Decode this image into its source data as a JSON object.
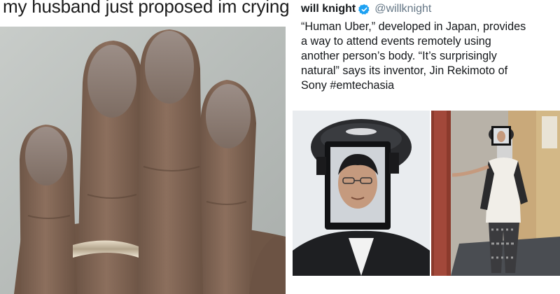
{
  "meme": {
    "caption": "my husband just proposed im crying"
  },
  "tweet": {
    "display_name": "will knight",
    "handle": "@willknight",
    "text_lines": [
      "“Human Uber,” developed in Japan, provides",
      "a way to attend events remotely using",
      "another person’s body. “It’s surprisingly",
      "natural” says its inventor, Jin Rekimoto of",
      "Sony"
    ],
    "hashtag": "#emtechasia"
  },
  "colors": {
    "verified_blue": "#1da1f2",
    "text_primary": "#14171a",
    "text_secondary": "#657786"
  },
  "icons": {
    "verified": "verified-badge-icon"
  }
}
